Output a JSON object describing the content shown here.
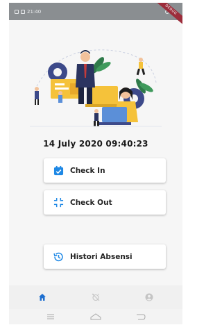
{
  "status_bar": {
    "time": "21:40"
  },
  "debug_banner": "DEBUG",
  "main": {
    "datetime": "14 July 2020 09:40:23",
    "buttons": {
      "check_in": "Check In",
      "check_out": "Check Out",
      "history": "Histori Absensi"
    }
  },
  "bottom_nav": {
    "items": [
      {
        "icon": "home-icon",
        "active": true
      },
      {
        "icon": "alarm-off-icon",
        "active": false
      },
      {
        "icon": "account-icon",
        "active": false
      }
    ]
  },
  "system_nav": {
    "items": [
      "menu-icon",
      "home-outline-icon",
      "back-icon"
    ]
  },
  "colors": {
    "accent": "#1e88e5",
    "nav_active": "#1e6fd0",
    "nav_inactive": "#c4c4c4",
    "illustration_yellow": "#f5c23a",
    "illustration_blue": "#3d4a8a"
  }
}
